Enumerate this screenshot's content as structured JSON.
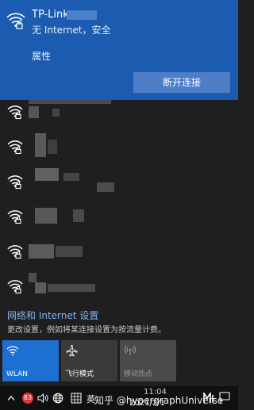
{
  "connected": {
    "ssid": "TP-Link_",
    "status": "无 Internet，安全",
    "properties_label": "属性",
    "disconnect_label": "断开连接"
  },
  "networks": [
    {
      "name": "",
      "secured": true
    },
    {
      "name": "",
      "secured": true
    },
    {
      "name": "",
      "secured": true
    },
    {
      "name": "",
      "secured": true
    },
    {
      "name": "",
      "secured": true
    },
    {
      "name": "",
      "secured": true
    }
  ],
  "settings": {
    "link_label": "网络和 Internet 设置",
    "description": "更改设置，例如将某连接设置为按流量计费。"
  },
  "quick_actions": [
    {
      "label": "WLAN",
      "state": "on",
      "icon": "wifi-icon"
    },
    {
      "label": "飞行模式",
      "state": "off",
      "icon": "airplane-icon"
    },
    {
      "label": "移动热点",
      "state": "disabled",
      "icon": "hotspot-icon"
    }
  ],
  "taskbar": {
    "notification_count": "83",
    "input_method": "英",
    "time": "11:04",
    "date": "2021/2/1",
    "watermark": "知乎 @hypergraphUniverse"
  },
  "colors": {
    "connected_bg": "#1b5cb0",
    "accent_link": "#7fb6ef",
    "tile_active": "#1d6fd1"
  }
}
